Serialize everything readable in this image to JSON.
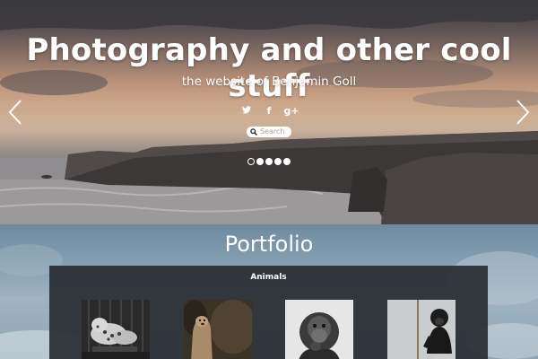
{
  "hero": {
    "title": "Photography and other cool stuff",
    "subtitle": "the website of Benjamin Goll",
    "social": [
      {
        "icon": "twitter-icon",
        "glyph": "❧"
      },
      {
        "icon": "facebook-icon",
        "glyph": "f"
      },
      {
        "icon": "google-plus-icon",
        "glyph": "g+"
      }
    ],
    "search": {
      "placeholder": "Search"
    },
    "slides": {
      "count": 5,
      "active": 1
    }
  },
  "portfolio": {
    "title": "Portfolio",
    "category": "Animals",
    "photos": [
      {
        "subject": "Snow leopard"
      },
      {
        "subject": "Meerkat"
      },
      {
        "subject": "Gorilla"
      },
      {
        "subject": "Chimpanzee"
      }
    ]
  }
}
